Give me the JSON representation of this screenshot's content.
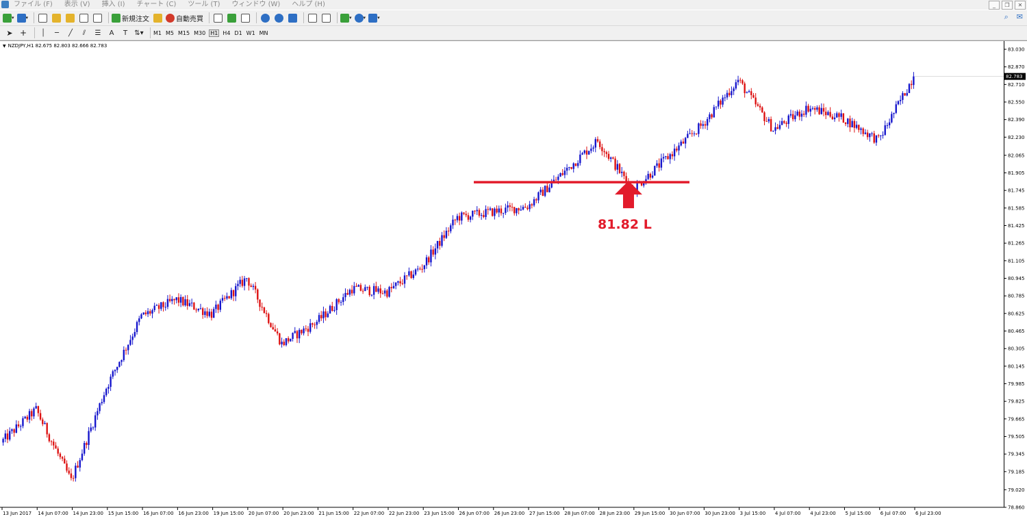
{
  "menu": {
    "items": [
      "ファイル (F)",
      "表示 (V)",
      "挿入 (I)",
      "チャート (C)",
      "ツール (T)",
      "ウィンドウ (W)",
      "ヘルプ (H)"
    ]
  },
  "toolbar": {
    "new_order_label": "新規注文",
    "auto_trading_label": "自動売買",
    "timeframes": [
      "M1",
      "M5",
      "M15",
      "M30",
      "H1",
      "H4",
      "D1",
      "W1",
      "MN"
    ],
    "active_timeframe": "H1"
  },
  "chart": {
    "header": "NZDJPY,H1  82.675 82.803 82.666 82.783",
    "current_price_label": "82.783",
    "price_axis_labels": [
      "83.030",
      "82.870",
      "82.710",
      "82.550",
      "82.390",
      "82.230",
      "82.065",
      "81.905",
      "81.745",
      "81.585",
      "81.425",
      "81.265",
      "81.105",
      "80.945",
      "80.785",
      "80.625",
      "80.465",
      "80.305",
      "80.145",
      "79.985",
      "79.825",
      "79.665",
      "79.505",
      "79.345",
      "79.185",
      "79.020",
      "78.860"
    ],
    "time_axis_labels": [
      "13 Jun 2017",
      "14 Jun 07:00",
      "14 Jun 23:00",
      "15 Jun 15:00",
      "16 Jun 07:00",
      "16 Jun 23:00",
      "19 Jun 15:00",
      "20 Jun 07:00",
      "20 Jun 23:00",
      "21 Jun 15:00",
      "22 Jun 07:00",
      "22 Jun 23:00",
      "23 Jun 15:00",
      "26 Jun 07:00",
      "26 Jun 23:00",
      "27 Jun 15:00",
      "28 Jun 07:00",
      "28 Jun 23:00",
      "29 Jun 15:00",
      "30 Jun 07:00",
      "30 Jun 23:00",
      "3 Jul 15:00",
      "4 Jul 07:00",
      "4 Jul 23:00",
      "5 Jul 15:00",
      "6 Jul 07:00",
      "6 Jul 23:00"
    ],
    "annotation_text": "81.82 L",
    "colors": {
      "bull": "#1515cc",
      "bear": "#dd1111",
      "annotation": "#e21b2b"
    }
  },
  "chart_data": {
    "type": "candlestick",
    "symbol": "NZDJPY",
    "timeframe": "H1",
    "last_ohlc": {
      "open": 82.675,
      "high": 82.803,
      "low": 82.666,
      "close": 82.783
    },
    "ylim": [
      78.86,
      83.03
    ],
    "close_path": [
      {
        "x": "13 Jun 2017",
        "close": 79.45
      },
      {
        "x": "14 Jun 07:00",
        "close": 79.75
      },
      {
        "x": "14 Jun 23:00",
        "close": 79.1
      },
      {
        "x": "15 Jun 15:00",
        "close": 79.95
      },
      {
        "x": "16 Jun 07:00",
        "close": 80.6
      },
      {
        "x": "16 Jun 23:00",
        "close": 80.75
      },
      {
        "x": "19 Jun 15:00",
        "close": 80.62
      },
      {
        "x": "20 Jun 07:00",
        "close": 80.95
      },
      {
        "x": "20 Jun 23:00",
        "close": 80.35
      },
      {
        "x": "21 Jun 15:00",
        "close": 80.55
      },
      {
        "x": "22 Jun 07:00",
        "close": 80.85
      },
      {
        "x": "22 Jun 23:00",
        "close": 80.82
      },
      {
        "x": "23 Jun 15:00",
        "close": 81.05
      },
      {
        "x": "26 Jun 07:00",
        "close": 81.5
      },
      {
        "x": "26 Jun 23:00",
        "close": 81.55
      },
      {
        "x": "27 Jun 15:00",
        "close": 81.6
      },
      {
        "x": "28 Jun 07:00",
        "close": 81.9
      },
      {
        "x": "28 Jun 23:00",
        "close": 82.2
      },
      {
        "x": "29 Jun 15:00",
        "close": 81.75
      },
      {
        "x": "30 Jun 07:00",
        "close": 82.05
      },
      {
        "x": "30 Jun 23:00",
        "close": 82.35
      },
      {
        "x": "3 Jul 15:00",
        "close": 82.75
      },
      {
        "x": "4 Jul 07:00",
        "close": 82.3
      },
      {
        "x": "4 Jul 23:00",
        "close": 82.5
      },
      {
        "x": "5 Jul 15:00",
        "close": 82.4
      },
      {
        "x": "6 Jul 07:00",
        "close": 82.2
      },
      {
        "x": "6 Jul 23:00",
        "close": 82.783
      }
    ],
    "horizontal_line": {
      "price": 81.82,
      "label": "81.82 L"
    }
  }
}
